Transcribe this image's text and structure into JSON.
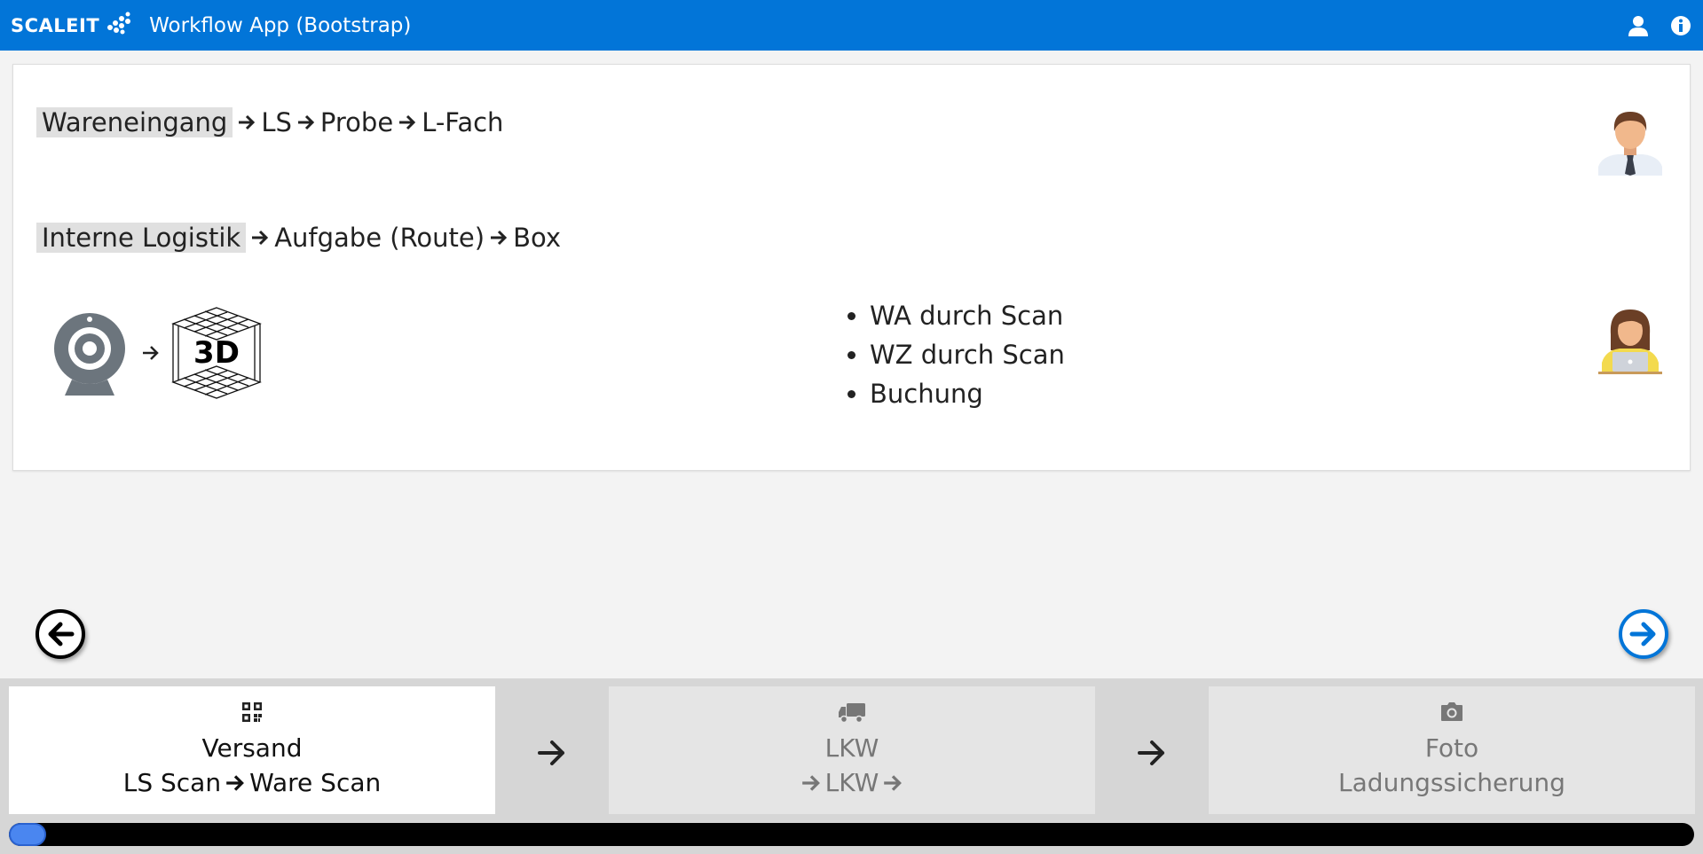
{
  "navbar": {
    "brand": "SCALEIT",
    "title": "Workflow App (Bootstrap)",
    "user_icon": "user-icon",
    "info_icon": "info-icon",
    "color": "#0275d8"
  },
  "content": {
    "row1": {
      "highlight": "Wareneingang",
      "steps": [
        "LS",
        "Probe",
        "L-Fach"
      ]
    },
    "row2": {
      "highlight": "Interne Logistik",
      "steps": [
        "Aufgabe (Route)",
        "Box"
      ]
    },
    "camera_icon": "webcam-icon",
    "model_icon": "3d-model-icon",
    "model_label": "3D",
    "bullets": [
      "WA durch Scan",
      "WZ durch Scan",
      "Buchung"
    ],
    "avatar_top": "man-avatar-icon",
    "avatar_bottom": "woman-laptop-avatar-icon"
  },
  "navigation": {
    "prev_icon": "arrow-left-circle-icon",
    "next_icon": "arrow-right-circle-icon"
  },
  "workflow_steps": [
    {
      "icon": "qr-code-icon",
      "title": "Versand",
      "sub_left": "LS Scan",
      "sub_right": "Ware Scan",
      "active": true
    },
    {
      "icon": "truck-icon",
      "title": "LKW",
      "sub_center": "LKW",
      "active": false
    },
    {
      "icon": "camera-icon",
      "title": "Foto",
      "sub": "Ladungssicherung",
      "active": false
    }
  ],
  "progress": {
    "value": 0.02,
    "fill_color": "#4a86f0"
  }
}
